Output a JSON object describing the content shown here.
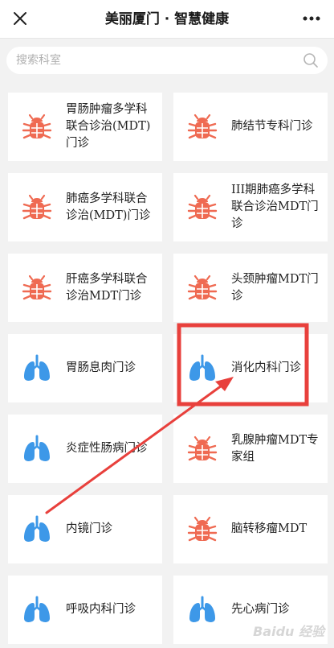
{
  "header": {
    "title": "美丽厦门 · 智慧健康",
    "close_icon": "close-icon",
    "more_icon": "more-icon"
  },
  "search": {
    "placeholder": "搜索科室",
    "icon": "search-icon"
  },
  "colors": {
    "bug_icon": "#ef6a52",
    "lung_icon": "#3d98e8",
    "highlight": "#e8403c",
    "arrow": "#e8403c"
  },
  "departments": [
    {
      "label": "胃肠肿瘤多学科联合诊治(MDT)门诊",
      "icon": "bug-icon"
    },
    {
      "label": "肺结节专科门诊",
      "icon": "bug-icon"
    },
    {
      "label": "肺癌多学科联合诊治(MDT)门诊",
      "icon": "bug-icon"
    },
    {
      "label": "III期肺癌多学科联合诊治MDT门诊",
      "icon": "bug-icon"
    },
    {
      "label": "肝癌多学科联合诊治MDT门诊",
      "icon": "bug-icon"
    },
    {
      "label": "头颈肿瘤MDT门诊",
      "icon": "bug-icon"
    },
    {
      "label": "胃肠息肉门诊",
      "icon": "lung-icon"
    },
    {
      "label": "消化内科门诊",
      "icon": "lung-icon"
    },
    {
      "label": "炎症性肠病门诊",
      "icon": "lung-icon"
    },
    {
      "label": "乳腺肿瘤MDT专家组",
      "icon": "bug-icon"
    },
    {
      "label": "内镜门诊",
      "icon": "lung-icon"
    },
    {
      "label": "脑转移瘤MDT",
      "icon": "bug-icon"
    },
    {
      "label": "呼吸内科门诊",
      "icon": "lung-icon"
    },
    {
      "label": "先心病门诊",
      "icon": "lung-icon"
    }
  ],
  "watermark": "Baidu 经验"
}
